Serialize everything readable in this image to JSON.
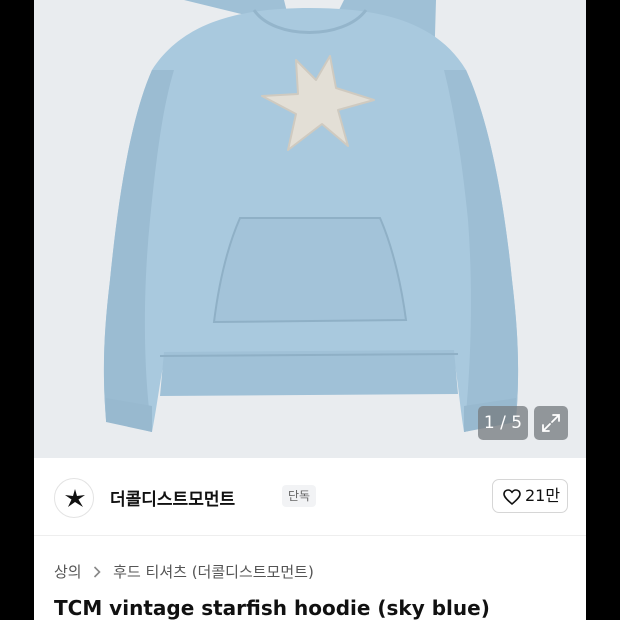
{
  "gallery": {
    "counter": "1 / 5",
    "image_subject": "hoodie-photo",
    "hoodie_color": "#a9c9de",
    "starfish_color": "#e3dfd6"
  },
  "seller": {
    "name": "더콜디스트모먼트",
    "badge": "단독",
    "avatar_icon": "starfish-logo-icon"
  },
  "like": {
    "count": "21만",
    "icon": "heart-outline-icon"
  },
  "breadcrumb": {
    "items": [
      "상의",
      "후드 티셔츠 (더콜디스트모먼트)"
    ],
    "separator_icon": "chevron-right-icon"
  },
  "product": {
    "title": "TCM vintage starfish hoodie (sky blue)"
  }
}
